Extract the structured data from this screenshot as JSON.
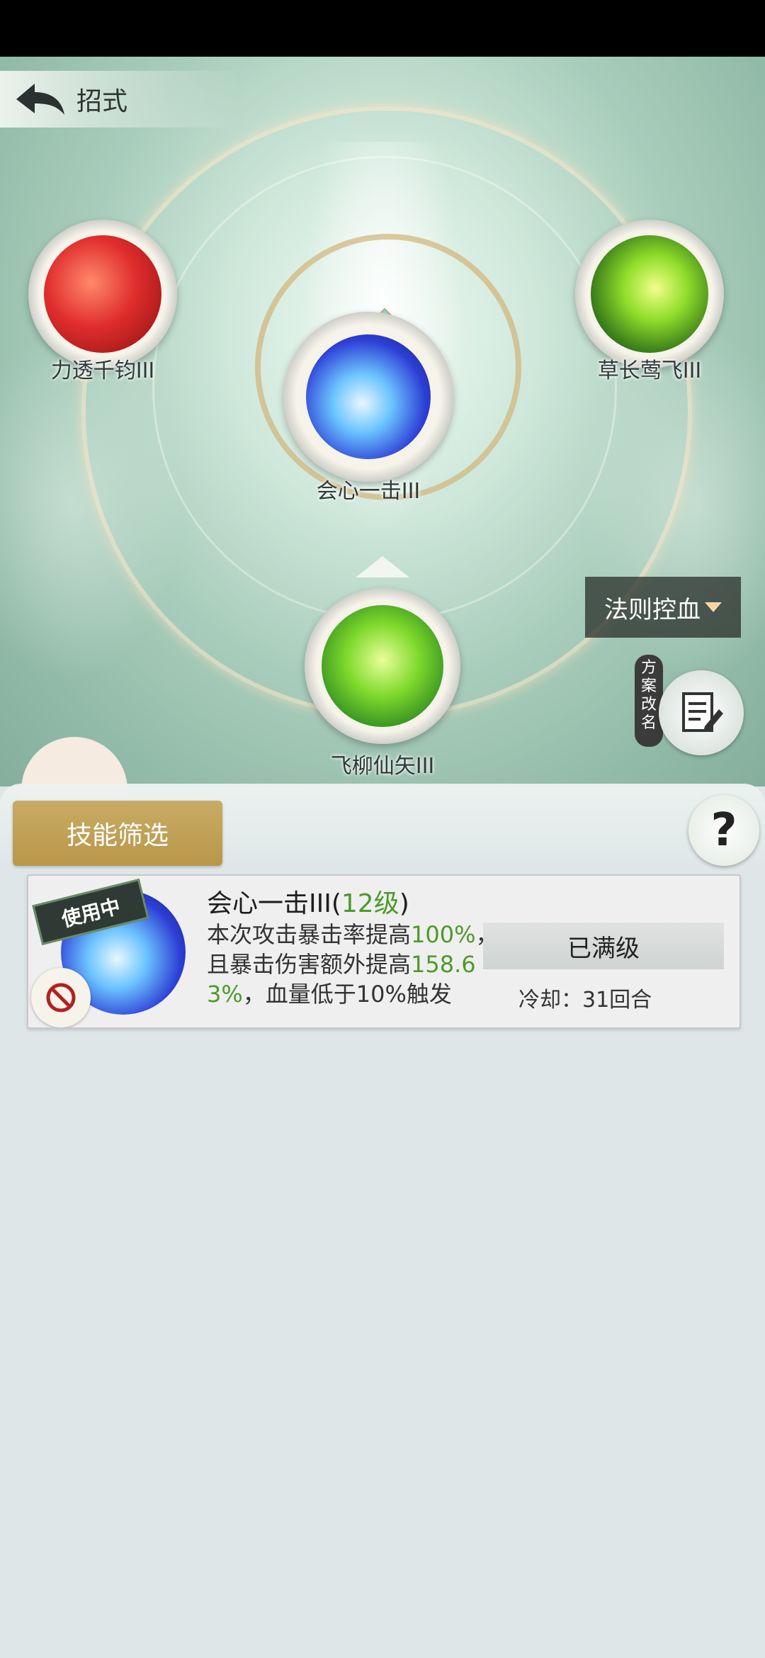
{
  "header": {
    "title": "招式"
  },
  "skills": {
    "top_left": {
      "name": "力透千钧III"
    },
    "top_right": {
      "name": "草长莺飞III"
    },
    "center": {
      "name": "会心一击III"
    },
    "bottom": {
      "name": "飞柳仙矢III"
    }
  },
  "scheme": {
    "name": "法则控血",
    "rename_label": "方案改名"
  },
  "panel": {
    "filter_label": "技能筛选",
    "help_label": "?"
  },
  "skill_card": {
    "badge": "使用中",
    "title": "会心一击III(",
    "level": "12级",
    "title_close": ")",
    "desc_1": "本次攻击暴击率提高",
    "desc_val_1": "100%",
    "desc_2": "，且暴击伤害额外提高",
    "desc_val_2": "158.63%",
    "desc_3": "，血量低于10%触发",
    "status": "已满级",
    "cooldown": "冷却：31回合"
  },
  "colors": {
    "level_green": "#4c9a2a",
    "filter_gold": "#c0a155"
  }
}
